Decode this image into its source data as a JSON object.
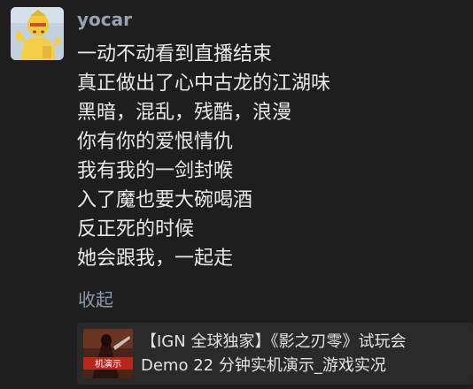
{
  "comment": {
    "username": "yocar",
    "avatar_icon": "yellow-figure-avatar",
    "lines": [
      "一动不动看到直播结束",
      "真正做出了心中古龙的江湖味",
      "黑暗，混乱，残酷，浪漫",
      "你有你的爱恨情仇",
      "我有我的一剑封喉",
      "入了魔也要大碗喝酒",
      "反正死的时候",
      "她会跟我，一起走"
    ],
    "collapse_label": "收起",
    "link_card": {
      "title_line1": "【IGN 全球独家】《影之刃零》试玩会",
      "title_line2": "Demo 22 分钟实机演示_游戏实况",
      "thumbnail_text": "机演示",
      "thumbnail_icon": "video-thumbnail"
    }
  },
  "colors": {
    "background": "#1e1e1e",
    "text": "#e9e9e9",
    "username": "#9aa2ad",
    "muted": "#8f98a5",
    "card": "#2a2a2a"
  }
}
